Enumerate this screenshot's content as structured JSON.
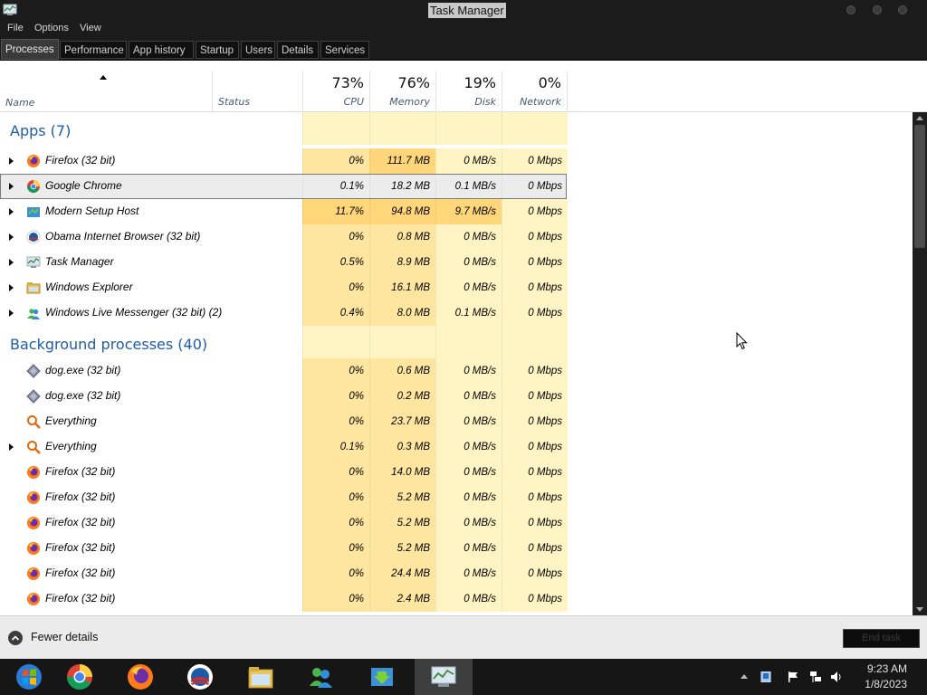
{
  "window": {
    "title": "Task Manager"
  },
  "menu": [
    "File",
    "Options",
    "View"
  ],
  "tabs": [
    "Processes",
    "Performance",
    "App history",
    "Startup",
    "Users",
    "Details",
    "Services"
  ],
  "columns": {
    "name": "Name",
    "status": "Status",
    "cpu": {
      "pct": "73%",
      "label": "CPU"
    },
    "memory": {
      "pct": "76%",
      "label": "Memory"
    },
    "disk": {
      "pct": "19%",
      "label": "Disk"
    },
    "network": {
      "pct": "0%",
      "label": "Network"
    }
  },
  "groups": {
    "apps": "Apps (7)",
    "background": "Background processes (40)"
  },
  "apps": [
    {
      "name": "Firefox (32 bit)",
      "icon": "firefox-icon",
      "expandable": true,
      "cpu": "0%",
      "memory": "111.7 MB",
      "disk": "0 MB/s",
      "network": "0 Mbps"
    },
    {
      "name": "Google Chrome",
      "icon": "chrome-icon",
      "expandable": true,
      "selected": true,
      "cpu": "0.1%",
      "memory": "18.2 MB",
      "disk": "0.1 MB/s",
      "network": "0 Mbps"
    },
    {
      "name": "Modern Setup Host",
      "icon": "setup-icon",
      "expandable": true,
      "cpu": "11.7%",
      "memory": "94.8 MB",
      "disk": "9.7 MB/s",
      "network": "0 Mbps"
    },
    {
      "name": "Obama Internet Browser (32 bit)",
      "icon": "obama-browser-icon",
      "expandable": true,
      "cpu": "0%",
      "memory": "0.8 MB",
      "disk": "0 MB/s",
      "network": "0 Mbps"
    },
    {
      "name": "Task Manager",
      "icon": "task-manager-icon",
      "expandable": true,
      "cpu": "0.5%",
      "memory": "8.9 MB",
      "disk": "0 MB/s",
      "network": "0 Mbps"
    },
    {
      "name": "Windows Explorer",
      "icon": "folder-icon",
      "expandable": true,
      "cpu": "0%",
      "memory": "16.1 MB",
      "disk": "0 MB/s",
      "network": "0 Mbps"
    },
    {
      "name": "Windows Live Messenger (32 bit) (2)",
      "icon": "messenger-icon",
      "expandable": true,
      "cpu": "0.4%",
      "memory": "8.0 MB",
      "disk": "0.1 MB/s",
      "network": "0 Mbps"
    }
  ],
  "background": [
    {
      "name": "dog.exe (32 bit)",
      "icon": "diamond-icon",
      "expandable": false,
      "cpu": "0%",
      "memory": "0.6 MB",
      "disk": "0 MB/s",
      "network": "0 Mbps"
    },
    {
      "name": "dog.exe (32 bit)",
      "icon": "diamond-icon",
      "expandable": false,
      "cpu": "0%",
      "memory": "0.2 MB",
      "disk": "0 MB/s",
      "network": "0 Mbps"
    },
    {
      "name": "Everything",
      "icon": "magnifier-icon",
      "expandable": false,
      "cpu": "0%",
      "memory": "23.7 MB",
      "disk": "0 MB/s",
      "network": "0 Mbps"
    },
    {
      "name": "Everything",
      "icon": "magnifier-icon",
      "expandable": true,
      "cpu": "0.1%",
      "memory": "0.3 MB",
      "disk": "0 MB/s",
      "network": "0 Mbps"
    },
    {
      "name": "Firefox (32 bit)",
      "icon": "firefox-icon",
      "expandable": false,
      "cpu": "0%",
      "memory": "14.0 MB",
      "disk": "0 MB/s",
      "network": "0 Mbps"
    },
    {
      "name": "Firefox (32 bit)",
      "icon": "firefox-icon",
      "expandable": false,
      "cpu": "0%",
      "memory": "5.2 MB",
      "disk": "0 MB/s",
      "network": "0 Mbps"
    },
    {
      "name": "Firefox (32 bit)",
      "icon": "firefox-icon",
      "expandable": false,
      "cpu": "0%",
      "memory": "5.2 MB",
      "disk": "0 MB/s",
      "network": "0 Mbps"
    },
    {
      "name": "Firefox (32 bit)",
      "icon": "firefox-icon",
      "expandable": false,
      "cpu": "0%",
      "memory": "5.2 MB",
      "disk": "0 MB/s",
      "network": "0 Mbps"
    },
    {
      "name": "Firefox (32 bit)",
      "icon": "firefox-icon",
      "expandable": false,
      "cpu": "0%",
      "memory": "24.4 MB",
      "disk": "0 MB/s",
      "network": "0 Mbps"
    },
    {
      "name": "Firefox (32 bit)",
      "icon": "firefox-icon",
      "expandable": false,
      "cpu": "0%",
      "memory": "2.4 MB",
      "disk": "0 MB/s",
      "network": "0 Mbps"
    }
  ],
  "footer": {
    "fewer_details": "Fewer details",
    "end_task": "End task"
  },
  "taskbar": {
    "buttons": [
      "start-icon",
      "chrome-icon",
      "firefox-icon",
      "obama-browser-icon",
      "file-explorer-icon",
      "messenger-icon",
      "download-icon",
      "task-manager-icon"
    ],
    "active": "task-manager-icon",
    "time": "9:23 AM",
    "date": "1/8/2023"
  },
  "colors": {
    "heat_low": "#fff4c4",
    "heat_mid": "#ffe6a0",
    "heat_high": "#ffd77a",
    "group_title": "#1f5ca8",
    "chrome": "#1b1b1b"
  }
}
